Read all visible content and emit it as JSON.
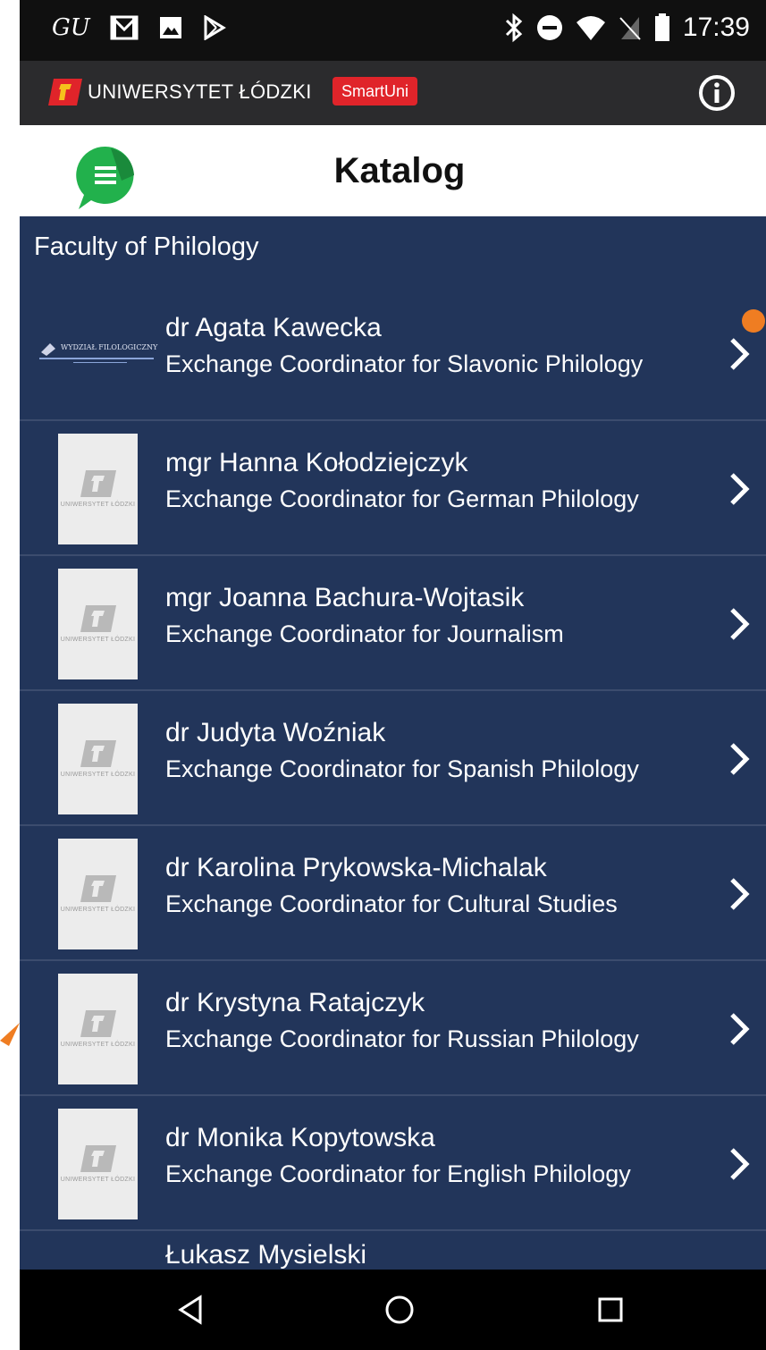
{
  "status_bar": {
    "carrier_text": "GU",
    "time": "17:39",
    "icons": [
      "gmail-icon",
      "image-icon",
      "play-store-icon",
      "bluetooth-icon",
      "do-not-disturb-icon",
      "wifi-icon",
      "no-sim-icon",
      "battery-icon"
    ]
  },
  "brand_bar": {
    "logo": "uniwersytet-lodzki-logo",
    "name": "UNIWERSYTET ŁÓDZKI",
    "badge": "SmartUni",
    "info_icon": "info-icon"
  },
  "title_bar": {
    "menu_icon": "menu-bubble-icon",
    "title": "Katalog"
  },
  "content": {
    "section_title": "Faculty of Philology",
    "items": [
      {
        "name": "dr Agata Kawecka",
        "role": "Exchange Coordinator for Slavonic Philology",
        "thumb": "wydzial-filologiczny-logo",
        "thumb_text": "WYDZIAŁ FILOLOGICZNY"
      },
      {
        "name": "mgr Hanna Kołodziejczyk",
        "role": "Exchange Coordinator for German Philology",
        "thumb": "university-placeholder",
        "thumb_text": "UNIWERSYTET ŁÓDZKI"
      },
      {
        "name": "mgr Joanna Bachura-Wojtasik",
        "role": "Exchange Coordinator for Journalism",
        "thumb": "university-placeholder",
        "thumb_text": "UNIWERSYTET ŁÓDZKI"
      },
      {
        "name": "dr Judyta Woźniak",
        "role": "Exchange Coordinator for Spanish Philology",
        "thumb": "university-placeholder",
        "thumb_text": "UNIWERSYTET ŁÓDZKI"
      },
      {
        "name": "dr Karolina Prykowska-Michalak",
        "role": "Exchange Coordinator for Cultural Studies",
        "thumb": "university-placeholder",
        "thumb_text": "UNIWERSYTET ŁÓDZKI"
      },
      {
        "name": "dr Krystyna Ratajczyk",
        "role": "Exchange Coordinator for Russian Philology",
        "thumb": "university-placeholder",
        "thumb_text": "UNIWERSYTET ŁÓDZKI"
      },
      {
        "name": "dr Monika Kopytowska",
        "role": "Exchange Coordinator for English Philology",
        "thumb": "university-placeholder",
        "thumb_text": "UNIWERSYTET ŁÓDZKI"
      }
    ],
    "partial_item_name": "Łukasz Mysielski"
  },
  "nav_bar": {
    "buttons": [
      "back-icon",
      "home-icon",
      "recents-icon"
    ]
  },
  "colors": {
    "list_background": "#22355a",
    "brand_red": "#e0242a",
    "annotation_orange": "#ef7d22"
  }
}
